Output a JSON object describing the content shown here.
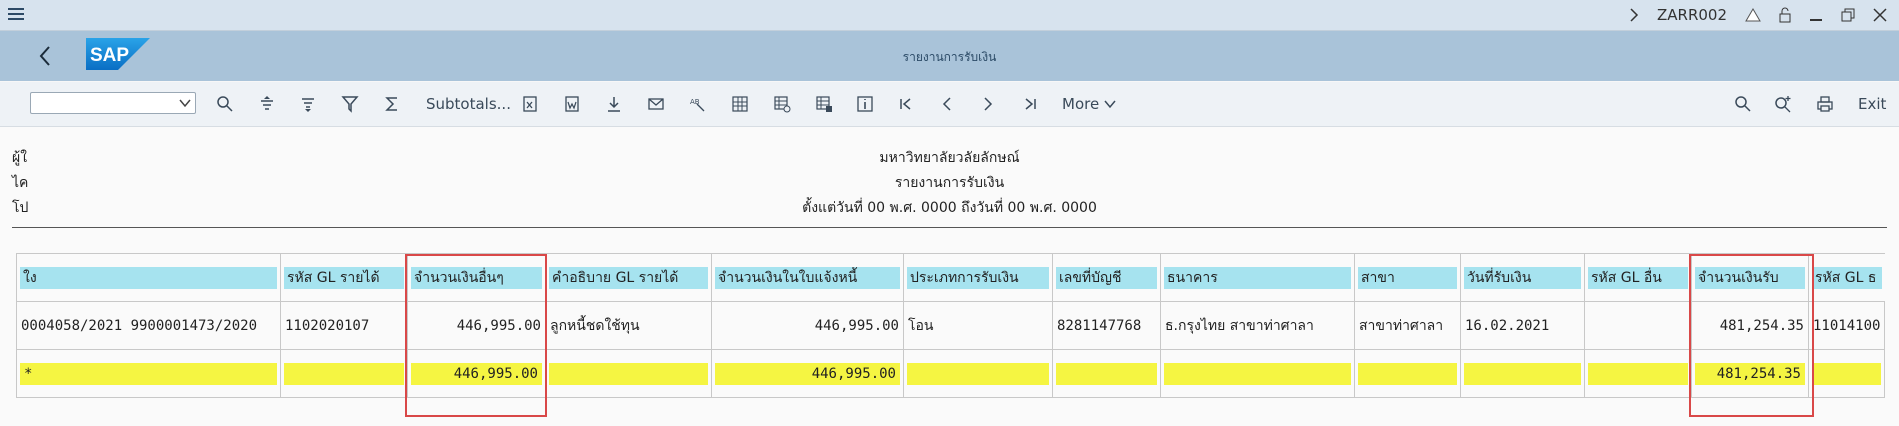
{
  "titlebar": {
    "system_id": "ZARR002"
  },
  "header": {
    "title": "รายงานการรับเงิน",
    "logo_text": "SAP"
  },
  "toolbar": {
    "layout_select_value": "",
    "subtotals_label": "Subtotals...",
    "more_label": "More",
    "exit_label": "Exit"
  },
  "report": {
    "left_labels": [
      "ผู้ใ",
      "ไค",
      "โป"
    ],
    "university": "มหาวิทยาลัยวลัยลักษณ์",
    "report_title": "รายงานการรับเงิน",
    "date_range": "ตั้งแต่วันที่ 00  พ.ศ. 0000 ถึงวันที่ 00  พ.ศ. 0000"
  },
  "table": {
    "columns": [
      "ใง",
      "รหัส GL รายได้",
      "จำนวนเงินอื่นๆ",
      "คำอธิบาย GL รายได้",
      "จำนวนเงินในใบแจ้งหนี้",
      "ประเภทการรับเงิน",
      "เลขที่บัญชี",
      "ธนาคาร",
      "สาขา",
      "วันที่รับเงิน",
      "รหัส GL อื่น",
      "จำนวนเงินรับ",
      "รหัส GL ธ"
    ],
    "rows": [
      [
        "0004058/2021 9900001473/2020",
        "1102020107",
        "446,995.00",
        "ลูกหนี้ชดใช้ทุน",
        "446,995.00",
        "โอน",
        "8281147768",
        "ธ.กรุงไทย สาขาท่าศาลา",
        "สาขาท่าศาลา",
        "16.02.2021",
        "",
        "481,254.35",
        "11014100"
      ]
    ],
    "totals": [
      "*",
      "",
      "446,995.00",
      "",
      "446,995.00",
      "",
      "",
      "",
      "",
      "",
      "",
      "481,254.35",
      ""
    ]
  },
  "colors": {
    "header_cell": "#a6e3ef",
    "total_cell": "#f5f542",
    "highlight": "#d94848"
  }
}
